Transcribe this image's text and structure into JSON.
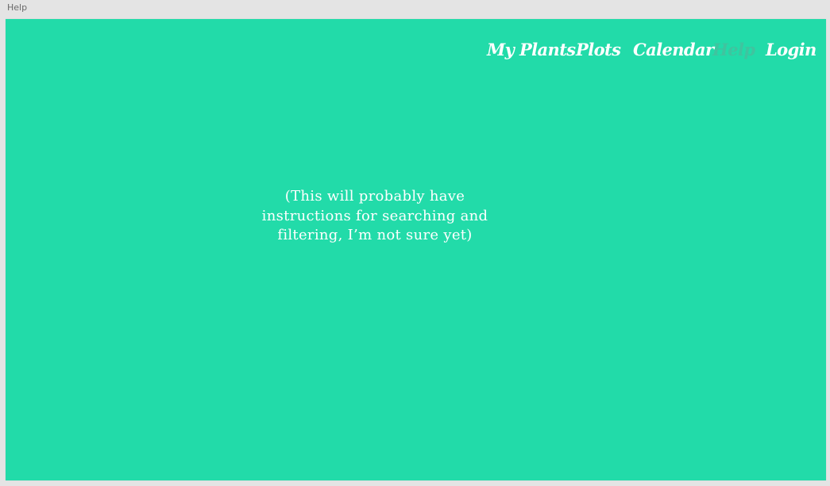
{
  "frame": {
    "label": "Help"
  },
  "colors": {
    "background": "#22dba9",
    "canvas": "#e4e4e4",
    "nav_text": "#ffffff",
    "nav_active_text": "#3fc49f"
  },
  "nav": {
    "items": [
      {
        "label": "My Plants",
        "active": false
      },
      {
        "label": "Plots",
        "active": false
      },
      {
        "label": "Calendar",
        "active": false
      },
      {
        "label": "Help",
        "active": true
      },
      {
        "label": "Login",
        "active": false
      }
    ]
  },
  "main": {
    "instructions_line1": "(This will probably have",
    "instructions_line2": "instructions for searching and",
    "instructions_line3": "filtering, I’m not sure yet)"
  }
}
